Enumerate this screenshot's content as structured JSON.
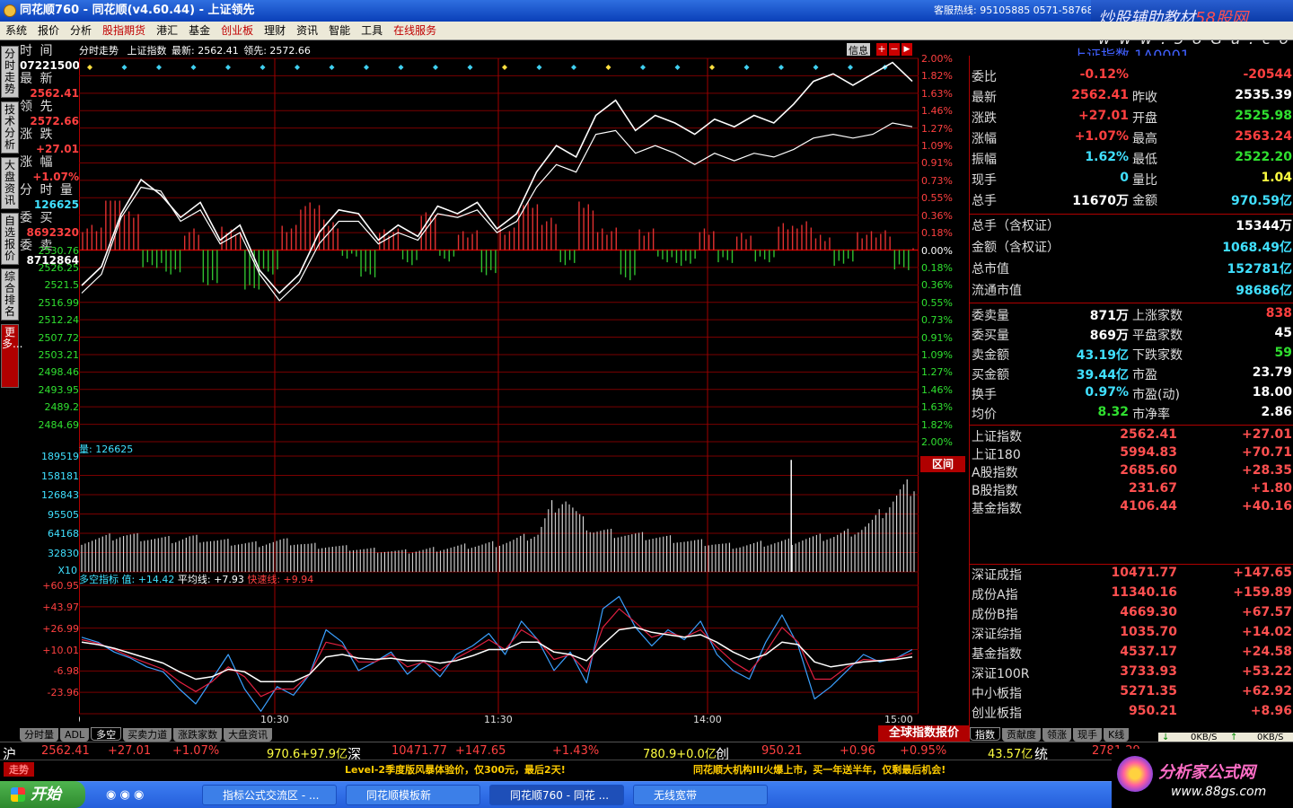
{
  "window": {
    "title": "同花顺760 - 同花顺(v4.60.44) - 上证领先",
    "hotline": "客服热线: 95105885  0571-58768",
    "brand_cn": "炒股辅助教材",
    "brand_suffix": "58股网",
    "brand_url": "w w w . 5 8 G u . c o m"
  },
  "menu": [
    "系统",
    "报价",
    "分析",
    "股指期货",
    "港汇",
    "基金",
    "创业板",
    "理财",
    "资讯",
    "智能",
    "工具",
    "在线服务"
  ],
  "menu_red": [
    "股指期货",
    "创业板",
    "在线服务"
  ],
  "lefttabs": [
    "分时走势",
    "技术分析",
    "大盘资讯",
    "自选报价",
    "综合排名",
    "更多..."
  ],
  "left_info": {
    "time_label": "时    间",
    "time_value": "07221500",
    "latest_label": "最    新",
    "latest_value": "2562.41",
    "lead_label": "领    先",
    "lead_value": "2572.66",
    "chg_label": "涨    跌",
    "chg_value": "+27.01",
    "pct_label": "涨    幅",
    "pct_value": "+1.07%",
    "vol_label": "分 时 量",
    "vol_value": "126625",
    "bid_label": "委    买",
    "bid_value": "8692320",
    "ask_label": "委    卖",
    "ask_value": "8712864"
  },
  "chart_header": {
    "name": "分时走势",
    "index": "上证指数",
    "latest": "最新: 2562.41",
    "lead": "领先: 2572.66",
    "info_btn": "信息"
  },
  "volume_header": "量: 126625",
  "indicator_header": {
    "name": "多空指标",
    "value": "值: +14.42",
    "avg": "平均线: +7.93",
    "fast": "快速线: +9.94"
  },
  "range_btn": "区间",
  "chart_data": [
    {
      "type": "line",
      "name": "intraday-price",
      "x": [
        "09:30",
        "10:30",
        "11:30",
        "14:00",
        "15:00"
      ],
      "yticks": [
        2530.76,
        2526.25,
        2521.5,
        2516.99,
        2512.24,
        2507.72,
        2503.21,
        2498.46,
        2493.95,
        2489.2,
        2484.69
      ],
      "pct_ticks": [
        "2.00%",
        "1.82%",
        "1.63%",
        "1.46%",
        "1.27%",
        "1.09%",
        "0.91%",
        "0.73%",
        "0.55%",
        "0.36%",
        "0.18%",
        "0.00%",
        "0.18%",
        "0.36%",
        "0.55%",
        "0.73%",
        "0.91%",
        "1.09%",
        "1.27%",
        "1.46%",
        "1.63%",
        "1.82%",
        "2.00%"
      ],
      "prev_close": 2535.39,
      "ylim": [
        2484.69,
        2586.09
      ],
      "series": [
        {
          "name": "最新",
          "values": [
            2526.0,
            2531.0,
            2545.0,
            2554.0,
            2550.0,
            2544.0,
            2548.0,
            2538.0,
            2542.0,
            2530.0,
            2524.0,
            2529.0,
            2540.0,
            2546.0,
            2545.0,
            2538.0,
            2542.0,
            2539.0,
            2547.0,
            2545.0,
            2548.0,
            2541.0,
            2545.0,
            2556.0,
            2563.0,
            2560.0,
            2571.0,
            2575.0,
            2567.0,
            2571.0,
            2569.0,
            2566.0,
            2570.0,
            2568.0,
            2571.0,
            2569.0,
            2574.0,
            2580.0,
            2582.0,
            2579.0,
            2582.0,
            2585.0,
            2580.0
          ]
        },
        {
          "name": "领先",
          "values": [
            2524.0,
            2529.0,
            2544.0,
            2552.0,
            2551.0,
            2543.0,
            2546.0,
            2537.0,
            2540.0,
            2529.0,
            2522.0,
            2527.0,
            2537.0,
            2543.0,
            2543.0,
            2537.0,
            2540.0,
            2538.0,
            2545.0,
            2544.0,
            2546.0,
            2540.0,
            2543.0,
            2552.0,
            2558.0,
            2556.0,
            2566.0,
            2567.0,
            2561.0,
            2563.0,
            2561.0,
            2558.0,
            2561.0,
            2559.0,
            2561.0,
            2560.0,
            2562.0,
            2565.0,
            2566.0,
            2565.0,
            2566.0,
            2569.0,
            2568.0
          ]
        }
      ]
    },
    {
      "type": "bar",
      "name": "intraday-volume",
      "yticks": [
        189519,
        158181,
        126843,
        95505,
        64168,
        32830
      ],
      "yunit": "X10",
      "ylim": [
        0,
        196000
      ],
      "values": [
        52000,
        55000,
        58000,
        62000,
        60000,
        57000,
        55000,
        54000,
        58000,
        56000,
        52000,
        50000,
        48000,
        47000,
        50000,
        52000,
        49000,
        45000,
        44000,
        42000,
        40000,
        38000,
        37000,
        35000,
        34000,
        36000,
        38000,
        40000,
        42000,
        44000,
        46000,
        48000,
        52000,
        58000,
        64000,
        110000,
        125000,
        92000,
        70000,
        68000,
        64000,
        62000,
        60000,
        58000,
        56000,
        52000,
        50000,
        48000,
        45000,
        44000,
        46000,
        48000,
        50000,
        52000,
        56000,
        58000,
        60000,
        66000,
        72000,
        85000,
        110000,
        135000,
        150000
      ],
      "spikes": [
        {
          "i": 37,
          "v": 189519
        }
      ]
    },
    {
      "type": "line",
      "name": "long-short-indicator",
      "yticks": [
        "+60.95",
        "+43.97",
        "+26.99",
        "+10.01",
        "-6.98",
        "-23.96"
      ],
      "ylim": [
        -40,
        64
      ],
      "series": [
        {
          "name": "值",
          "values": [
            22,
            18,
            10,
            5,
            -2,
            -6,
            -20,
            -32,
            -12,
            8,
            -20,
            -38,
            -18,
            -25,
            -8,
            28,
            18,
            -5,
            2,
            10,
            -8,
            3,
            -10,
            8,
            15,
            25,
            8,
            35,
            20,
            -5,
            10,
            -15,
            45,
            55,
            30,
            15,
            28,
            20,
            35,
            8,
            -5,
            -12,
            18,
            40,
            15,
            -28,
            -18,
            -5,
            8,
            2,
            5,
            12
          ]
        },
        {
          "name": "快速线",
          "values": [
            20,
            17,
            12,
            6,
            1,
            -4,
            -14,
            -22,
            -14,
            -2,
            -10,
            -26,
            -20,
            -20,
            -8,
            18,
            15,
            2,
            2,
            8,
            -2,
            2,
            -5,
            5,
            12,
            20,
            12,
            28,
            20,
            4,
            8,
            -6,
            30,
            45,
            34,
            22,
            26,
            22,
            28,
            14,
            2,
            -6,
            10,
            30,
            18,
            -12,
            -12,
            -2,
            4,
            3,
            5,
            9
          ]
        },
        {
          "name": "平均线",
          "values": [
            18,
            16,
            13,
            9,
            5,
            1,
            -6,
            -12,
            -10,
            -4,
            -6,
            -14,
            -14,
            -14,
            -8,
            6,
            8,
            5,
            4,
            5,
            3,
            3,
            1,
            3,
            7,
            12,
            12,
            18,
            18,
            10,
            8,
            3,
            16,
            28,
            30,
            26,
            24,
            22,
            24,
            18,
            10,
            4,
            8,
            18,
            16,
            2,
            -2,
            0,
            2,
            3,
            4,
            6
          ]
        }
      ]
    }
  ],
  "xlabels": [
    "09:30",
    "10:30",
    "11:30",
    "14:00",
    "15:00"
  ],
  "right": {
    "title": "上证指数 1A0001",
    "rows": [
      {
        "k": "委比",
        "v": "-0.12%",
        "vc": "red",
        "k2": "",
        "v2": "-20544",
        "v2c": "red"
      },
      {
        "k": "最新",
        "v": "2562.41",
        "vc": "red",
        "k2": "昨收",
        "v2": "2535.39",
        "v2c": "wht"
      },
      {
        "k": "涨跌",
        "v": "+27.01",
        "vc": "red",
        "k2": "开盘",
        "v2": "2525.98",
        "v2c": "grn"
      },
      {
        "k": "涨幅",
        "v": "+1.07%",
        "vc": "red",
        "k2": "最高",
        "v2": "2563.24",
        "v2c": "red"
      },
      {
        "k": "振幅",
        "v": "1.62%",
        "vc": "cyn",
        "k2": "最低",
        "v2": "2522.20",
        "v2c": "grn"
      },
      {
        "k": "现手",
        "v": "0",
        "vc": "cyn",
        "k2": "量比",
        "v2": "1.04",
        "v2c": "yel"
      },
      {
        "k": "总手",
        "v": "11670万",
        "vc": "wht",
        "k2": "金额",
        "v2": "970.59亿",
        "v2c": "cyn"
      }
    ],
    "wide_rows": [
      {
        "k": "总手（含权证）",
        "v": "15344万",
        "vc": "wht"
      },
      {
        "k": "金额（含权证）",
        "v": "1068.49亿",
        "vc": "cyn"
      },
      {
        "k": "总市值",
        "v": "152781亿",
        "vc": "cyn"
      },
      {
        "k": "流通市值",
        "v": "98686亿",
        "vc": "cyn"
      }
    ],
    "rows2": [
      {
        "k": "委卖量",
        "v": "871万",
        "vc": "wht",
        "k2": "上涨家数",
        "v2": "838",
        "v2c": "red"
      },
      {
        "k": "委买量",
        "v": "869万",
        "vc": "wht",
        "k2": "平盘家数",
        "v2": "45",
        "v2c": "wht"
      },
      {
        "k": "卖金额",
        "v": "43.19亿",
        "vc": "cyn",
        "k2": "下跌家数",
        "v2": "59",
        "v2c": "grn"
      },
      {
        "k": "买金额",
        "v": "39.44亿",
        "vc": "cyn",
        "k2": "市盈",
        "v2": "23.79",
        "v2c": "wht"
      },
      {
        "k": "换手",
        "v": "0.97%",
        "vc": "cyn",
        "k2": "市盈(动)",
        "v2": "18.00",
        "v2c": "wht"
      },
      {
        "k": "均价",
        "v": "8.32",
        "vc": "grn",
        "k2": "市净率",
        "v2": "2.86",
        "v2c": "wht"
      }
    ],
    "indices_sh": [
      {
        "n": "上证指数",
        "p": "2562.41",
        "c": "+27.01"
      },
      {
        "n": "上证180",
        "p": "5994.83",
        "c": "+70.71"
      },
      {
        "n": "A股指数",
        "p": "2685.60",
        "c": "+28.35"
      },
      {
        "n": "B股指数",
        "p": "231.67",
        "c": "+1.80"
      },
      {
        "n": "基金指数",
        "p": "4106.44",
        "c": "+40.16"
      }
    ],
    "indices_sz": [
      {
        "n": "深证成指",
        "p": "10471.77",
        "c": "+147.65"
      },
      {
        "n": "成份A指",
        "p": "11340.16",
        "c": "+159.89"
      },
      {
        "n": "成份B指",
        "p": "4669.30",
        "c": "+67.57"
      },
      {
        "n": "深证综指",
        "p": "1035.70",
        "c": "+14.02"
      },
      {
        "n": "基金指数",
        "p": "4537.17",
        "c": "+24.58"
      },
      {
        "n": "深证100R",
        "p": "3733.93",
        "c": "+53.22"
      },
      {
        "n": "中小板指",
        "p": "5271.35",
        "c": "+62.92"
      },
      {
        "n": "创业板指",
        "p": "950.21",
        "c": "+8.96"
      }
    ]
  },
  "bottom_tabs": [
    "分时量",
    "ADL",
    "多空",
    "买卖力道",
    "涨跌家数",
    "大盘资讯"
  ],
  "bottom_tab_active": "多空",
  "global_btn": "全球指数报价",
  "right_tabs": [
    "指数",
    "贡献度",
    "领涨",
    "现手",
    "K线"
  ],
  "net": {
    "down": "0KB/S",
    "up": "0KB/S"
  },
  "ticker": [
    {
      "t": "沪",
      "c": "wht"
    },
    {
      "t": "2562.41",
      "c": "red"
    },
    {
      "t": "+27.01",
      "c": "red"
    },
    {
      "t": "+1.07%",
      "c": "red"
    },
    {
      "t": "970.6+97.9亿",
      "c": "yel"
    },
    {
      "t": "深",
      "c": "wht"
    },
    {
      "t": "10471.77",
      "c": "red"
    },
    {
      "t": "+147.65",
      "c": "red"
    },
    {
      "t": "+1.43%",
      "c": "red"
    },
    {
      "t": "780.9+0.0亿",
      "c": "yel"
    },
    {
      "t": "创",
      "c": "wht"
    },
    {
      "t": "950.21",
      "c": "red"
    },
    {
      "t": "+0.96",
      "c": "red"
    },
    {
      "t": "+0.95%",
      "c": "red"
    },
    {
      "t": "43.57亿",
      "c": "yel"
    },
    {
      "t": "统",
      "c": "wht"
    },
    {
      "t": "2781.29",
      "c": "red"
    }
  ],
  "news": [
    "Level-2季度版风暴体验价，仅300元，最后2天!",
    "同花顺大机构III火爆上市，买一年送半年，仅剩最后机会!"
  ],
  "news_badge": "走势",
  "taskbar": {
    "start": "开始",
    "tasks": [
      "指标公式交流区 - ...",
      "同花顺模板新",
      "同花顺760 - 同花 ...",
      "无线宽带"
    ]
  },
  "brand_bottom": {
    "name": "分析家公式网",
    "url": "www.88gs.com"
  }
}
